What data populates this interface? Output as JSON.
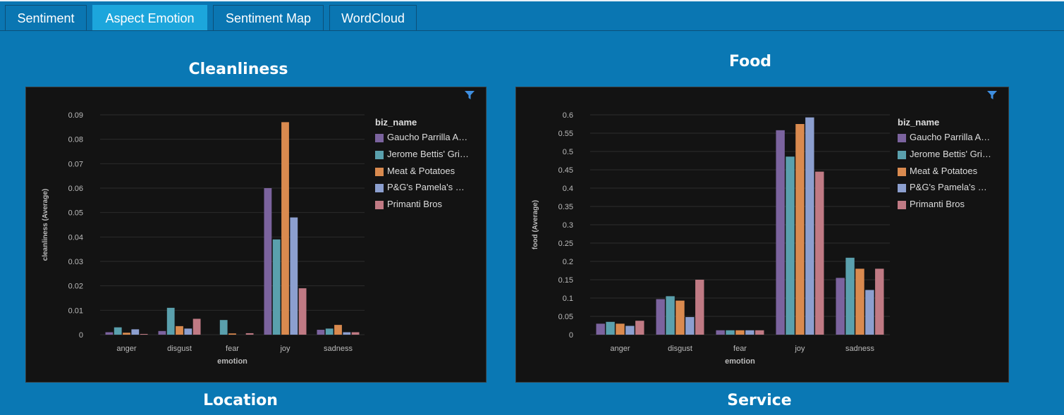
{
  "tabs": [
    {
      "label": "Sentiment",
      "active": false
    },
    {
      "label": "Aspect Emotion",
      "active": true
    },
    {
      "label": "Sentiment Map",
      "active": false
    },
    {
      "label": "WordCloud",
      "active": false
    }
  ],
  "sections": {
    "cleanliness": "Cleanliness",
    "food": "Food",
    "location": "Location",
    "service": "Service"
  },
  "legend": {
    "title": "biz_name",
    "items": [
      {
        "label": "Gaucho Parrilla A…",
        "color": "#7b639e"
      },
      {
        "label": "Jerome Bettis' Gri…",
        "color": "#5aa0ad"
      },
      {
        "label": "Meat & Potatoes",
        "color": "#d98a4f"
      },
      {
        "label": "P&G's Pamela's …",
        "color": "#8c9fcf"
      },
      {
        "label": "Primanti Bros",
        "color": "#c07a84"
      }
    ]
  },
  "chart_data": [
    {
      "type": "bar",
      "title": "Cleanliness",
      "xlabel": "emotion",
      "ylabel": "cleanliness (Average)",
      "categories": [
        "anger",
        "disgust",
        "fear",
        "joy",
        "sadness"
      ],
      "yticks": [
        "0",
        "0.01",
        "0.02",
        "0.03",
        "0.04",
        "0.05",
        "0.06",
        "0.07",
        "0.08",
        "0.09"
      ],
      "ylim": [
        0,
        0.09
      ],
      "grid": true,
      "legend_position": "right",
      "series": [
        {
          "name": "Gaucho Parrilla A…",
          "values": [
            0.001,
            0.0015,
            0,
            0.06,
            0.002
          ]
        },
        {
          "name": "Jerome Bettis' Gri…",
          "values": [
            0.003,
            0.011,
            0.006,
            0.039,
            0.0025
          ]
        },
        {
          "name": "Meat & Potatoes",
          "values": [
            0.0008,
            0.0035,
            0.0005,
            0.087,
            0.004
          ]
        },
        {
          "name": "P&G's Pamela's …",
          "values": [
            0.0022,
            0.0025,
            0,
            0.048,
            0.001
          ]
        },
        {
          "name": "Primanti Bros",
          "values": [
            0.0003,
            0.0065,
            0.0006,
            0.019,
            0.001
          ]
        }
      ]
    },
    {
      "type": "bar",
      "title": "Food",
      "xlabel": "emotion",
      "ylabel": "food (Average)",
      "categories": [
        "anger",
        "disgust",
        "fear",
        "joy",
        "sadness"
      ],
      "yticks": [
        "0",
        "0.05",
        "0.1",
        "0.15",
        "0.2",
        "0.25",
        "0.3",
        "0.35",
        "0.4",
        "0.45",
        "0.5",
        "0.55",
        "0.6"
      ],
      "ylim": [
        0,
        0.6
      ],
      "grid": true,
      "legend_position": "right",
      "series": [
        {
          "name": "Gaucho Parrilla A…",
          "values": [
            0.03,
            0.097,
            0.012,
            0.558,
            0.155
          ]
        },
        {
          "name": "Jerome Bettis' Gri…",
          "values": [
            0.035,
            0.105,
            0.012,
            0.486,
            0.21
          ]
        },
        {
          "name": "Meat & Potatoes",
          "values": [
            0.03,
            0.093,
            0.012,
            0.575,
            0.18
          ]
        },
        {
          "name": "P&G's Pamela's …",
          "values": [
            0.024,
            0.048,
            0.012,
            0.593,
            0.122
          ]
        },
        {
          "name": "Primanti Bros",
          "values": [
            0.038,
            0.15,
            0.012,
            0.445,
            0.18
          ]
        }
      ]
    }
  ]
}
